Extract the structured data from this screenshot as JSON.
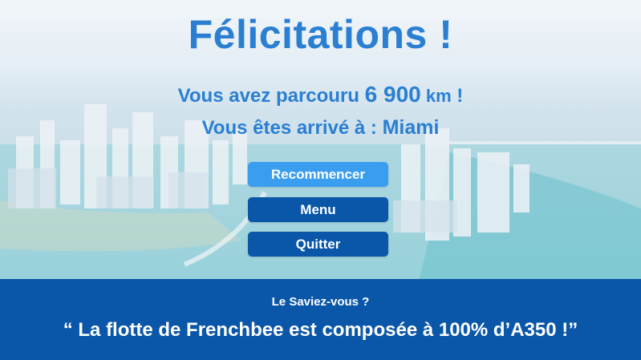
{
  "screen": {
    "title": "Félicitations !",
    "distance_prefix": "Vous avez parcouru ",
    "distance_value": "6 900",
    "distance_unit": " km",
    "distance_suffix": " !",
    "arrival_prefix": "Vous êtes arrivé à : ",
    "arrival_city": "Miami"
  },
  "buttons": {
    "restart": "Recommencer",
    "menu": "Menu",
    "quit": "Quitter"
  },
  "fact": {
    "heading": "Le Saviez-vous ?",
    "text": "“ La flotte de Frenchbee est composée à 100% d’A350 !”"
  },
  "colors": {
    "title_blue": "#2a7fd2",
    "button_light": "#3a9ef0",
    "button_dark": "#0a56a8",
    "banner": "#0a56a8"
  },
  "icons": {
    "background": "aerial-city-background"
  }
}
